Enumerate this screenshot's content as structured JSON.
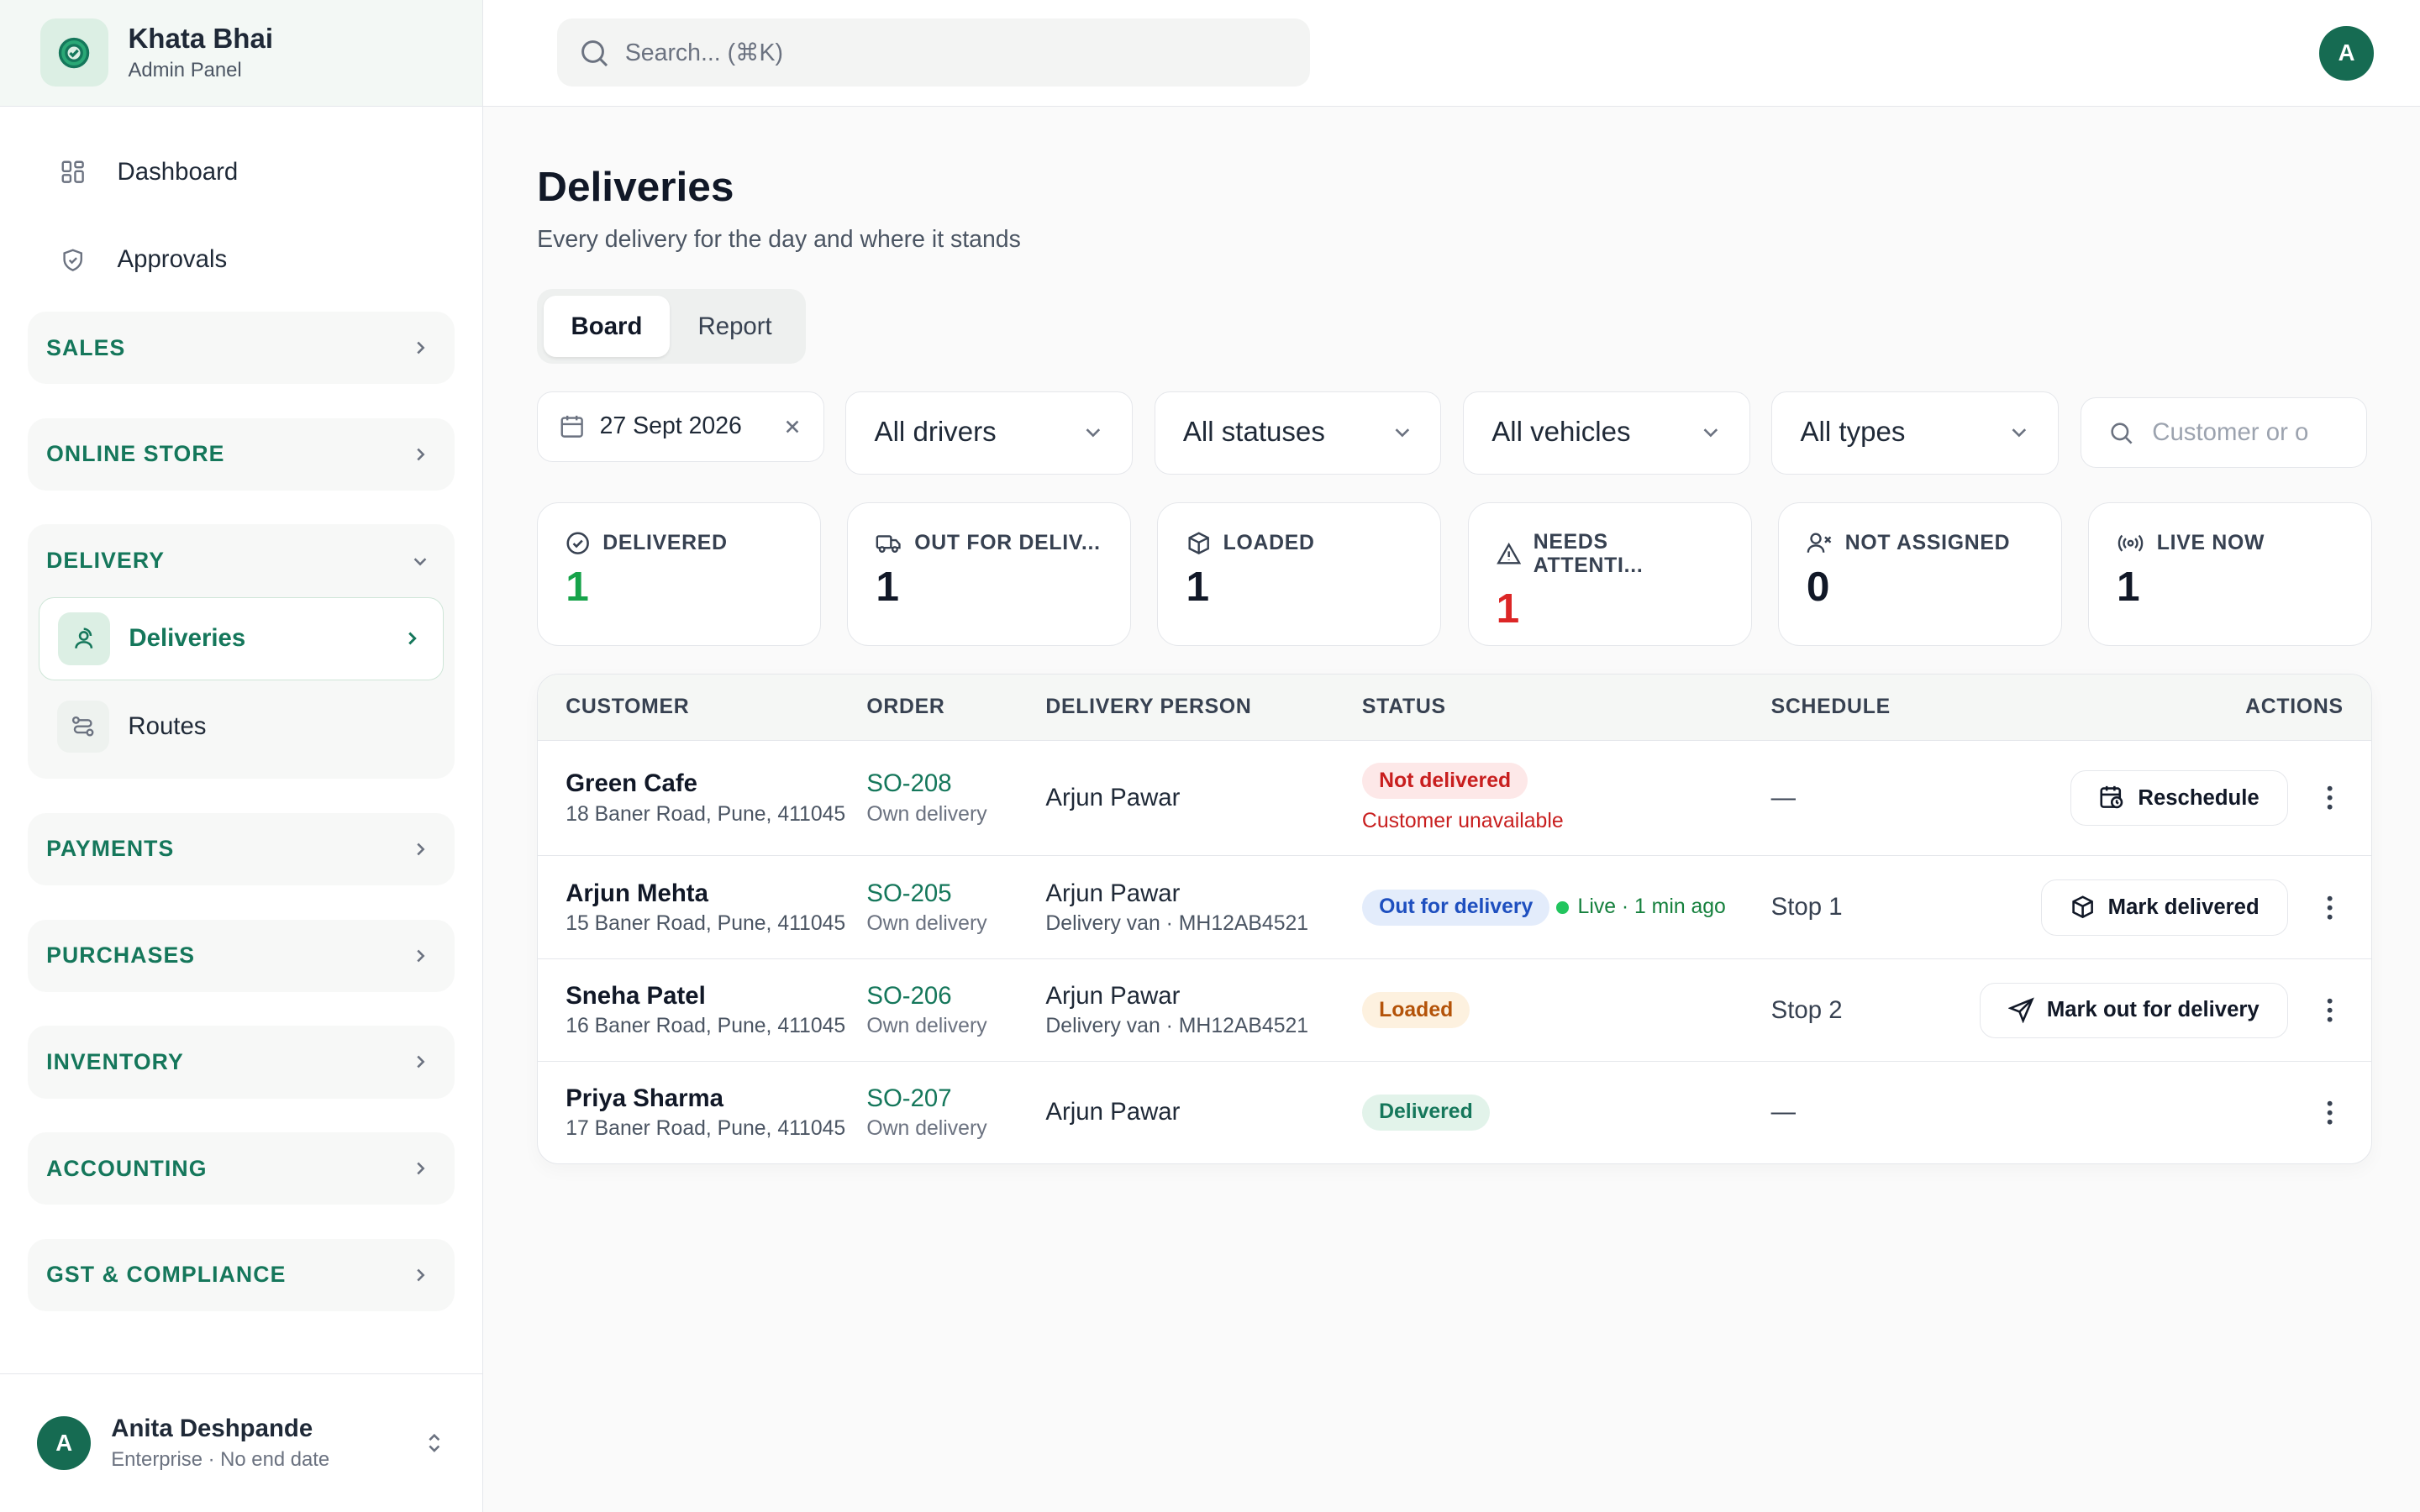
{
  "brand": {
    "title": "Khata Bhai",
    "subtitle": "Admin Panel"
  },
  "nav": {
    "top": [
      {
        "label": "Dashboard",
        "icon": "grid-icon"
      },
      {
        "label": "Approvals",
        "icon": "shield-icon"
      }
    ],
    "groups": {
      "sales": "SALES",
      "online_store": "ONLINE STORE",
      "delivery": "DELIVERY",
      "payments": "PAYMENTS",
      "purchases": "PURCHASES",
      "inventory": "INVENTORY",
      "accounting": "ACCOUNTING",
      "gst": "GST & COMPLIANCE"
    },
    "delivery_items": [
      {
        "label": "Deliveries",
        "active": true
      },
      {
        "label": "Routes",
        "active": false
      }
    ]
  },
  "user": {
    "initial": "A",
    "name": "Anita Deshpande",
    "plan": "Enterprise · No end date"
  },
  "topbar": {
    "search_placeholder": "Search... (⌘K)",
    "avatar_initial": "A"
  },
  "page": {
    "title": "Deliveries",
    "subtitle": "Every delivery for the day and where it stands"
  },
  "tabs": [
    "Board",
    "Report"
  ],
  "filters": {
    "date": "27 Sept 2026",
    "drivers": "All drivers",
    "statuses": "All statuses",
    "vehicles": "All vehicles",
    "types": "All types",
    "search_placeholder": "Customer or o"
  },
  "stats": [
    {
      "label": "DELIVERED",
      "value": "1",
      "color": "#16a34a",
      "icon": "check-circle-icon"
    },
    {
      "label": "OUT FOR DELIV...",
      "value": "1",
      "color": "#111827",
      "icon": "truck-icon"
    },
    {
      "label": "LOADED",
      "value": "1",
      "color": "#111827",
      "icon": "package-icon"
    },
    {
      "label": "NEEDS ATTENTI...",
      "value": "1",
      "color": "#dc2626",
      "icon": "alert-triangle-icon"
    },
    {
      "label": "NOT ASSIGNED",
      "value": "0",
      "color": "#111827",
      "icon": "user-x-icon"
    },
    {
      "label": "LIVE NOW",
      "value": "1",
      "color": "#111827",
      "icon": "broadcast-icon"
    }
  ],
  "table": {
    "headers": [
      "CUSTOMER",
      "ORDER",
      "DELIVERY PERSON",
      "STATUS",
      "SCHEDULE",
      "ACTIONS"
    ],
    "rows": [
      {
        "customer": "Green Cafe",
        "address": "18 Baner Road, Pune, 411045",
        "order": "SO-208",
        "order_type": "Own delivery",
        "person": "Arjun Pawar",
        "vehicle": "",
        "status": "Not delivered",
        "reason": "Customer unavailable",
        "live": "",
        "schedule": "—",
        "action": "Reschedule"
      },
      {
        "customer": "Arjun Mehta",
        "address": "15 Baner Road, Pune, 411045",
        "order": "SO-205",
        "order_type": "Own delivery",
        "person": "Arjun Pawar",
        "vehicle": "Delivery van · MH12AB4521",
        "status": "Out for delivery",
        "reason": "",
        "live": "Live · 1 min ago",
        "schedule": "Stop 1",
        "action": "Mark delivered"
      },
      {
        "customer": "Sneha Patel",
        "address": "16 Baner Road, Pune, 411045",
        "order": "SO-206",
        "order_type": "Own delivery",
        "person": "Arjun Pawar",
        "vehicle": "Delivery van · MH12AB4521",
        "status": "Loaded",
        "reason": "",
        "live": "",
        "schedule": "Stop 2",
        "action": "Mark out for delivery"
      },
      {
        "customer": "Priya Sharma",
        "address": "17 Baner Road, Pune, 411045",
        "order": "SO-207",
        "order_type": "Own delivery",
        "person": "Arjun Pawar",
        "vehicle": "",
        "status": "Delivered",
        "reason": "",
        "live": "",
        "schedule": "—",
        "action": ""
      }
    ]
  }
}
